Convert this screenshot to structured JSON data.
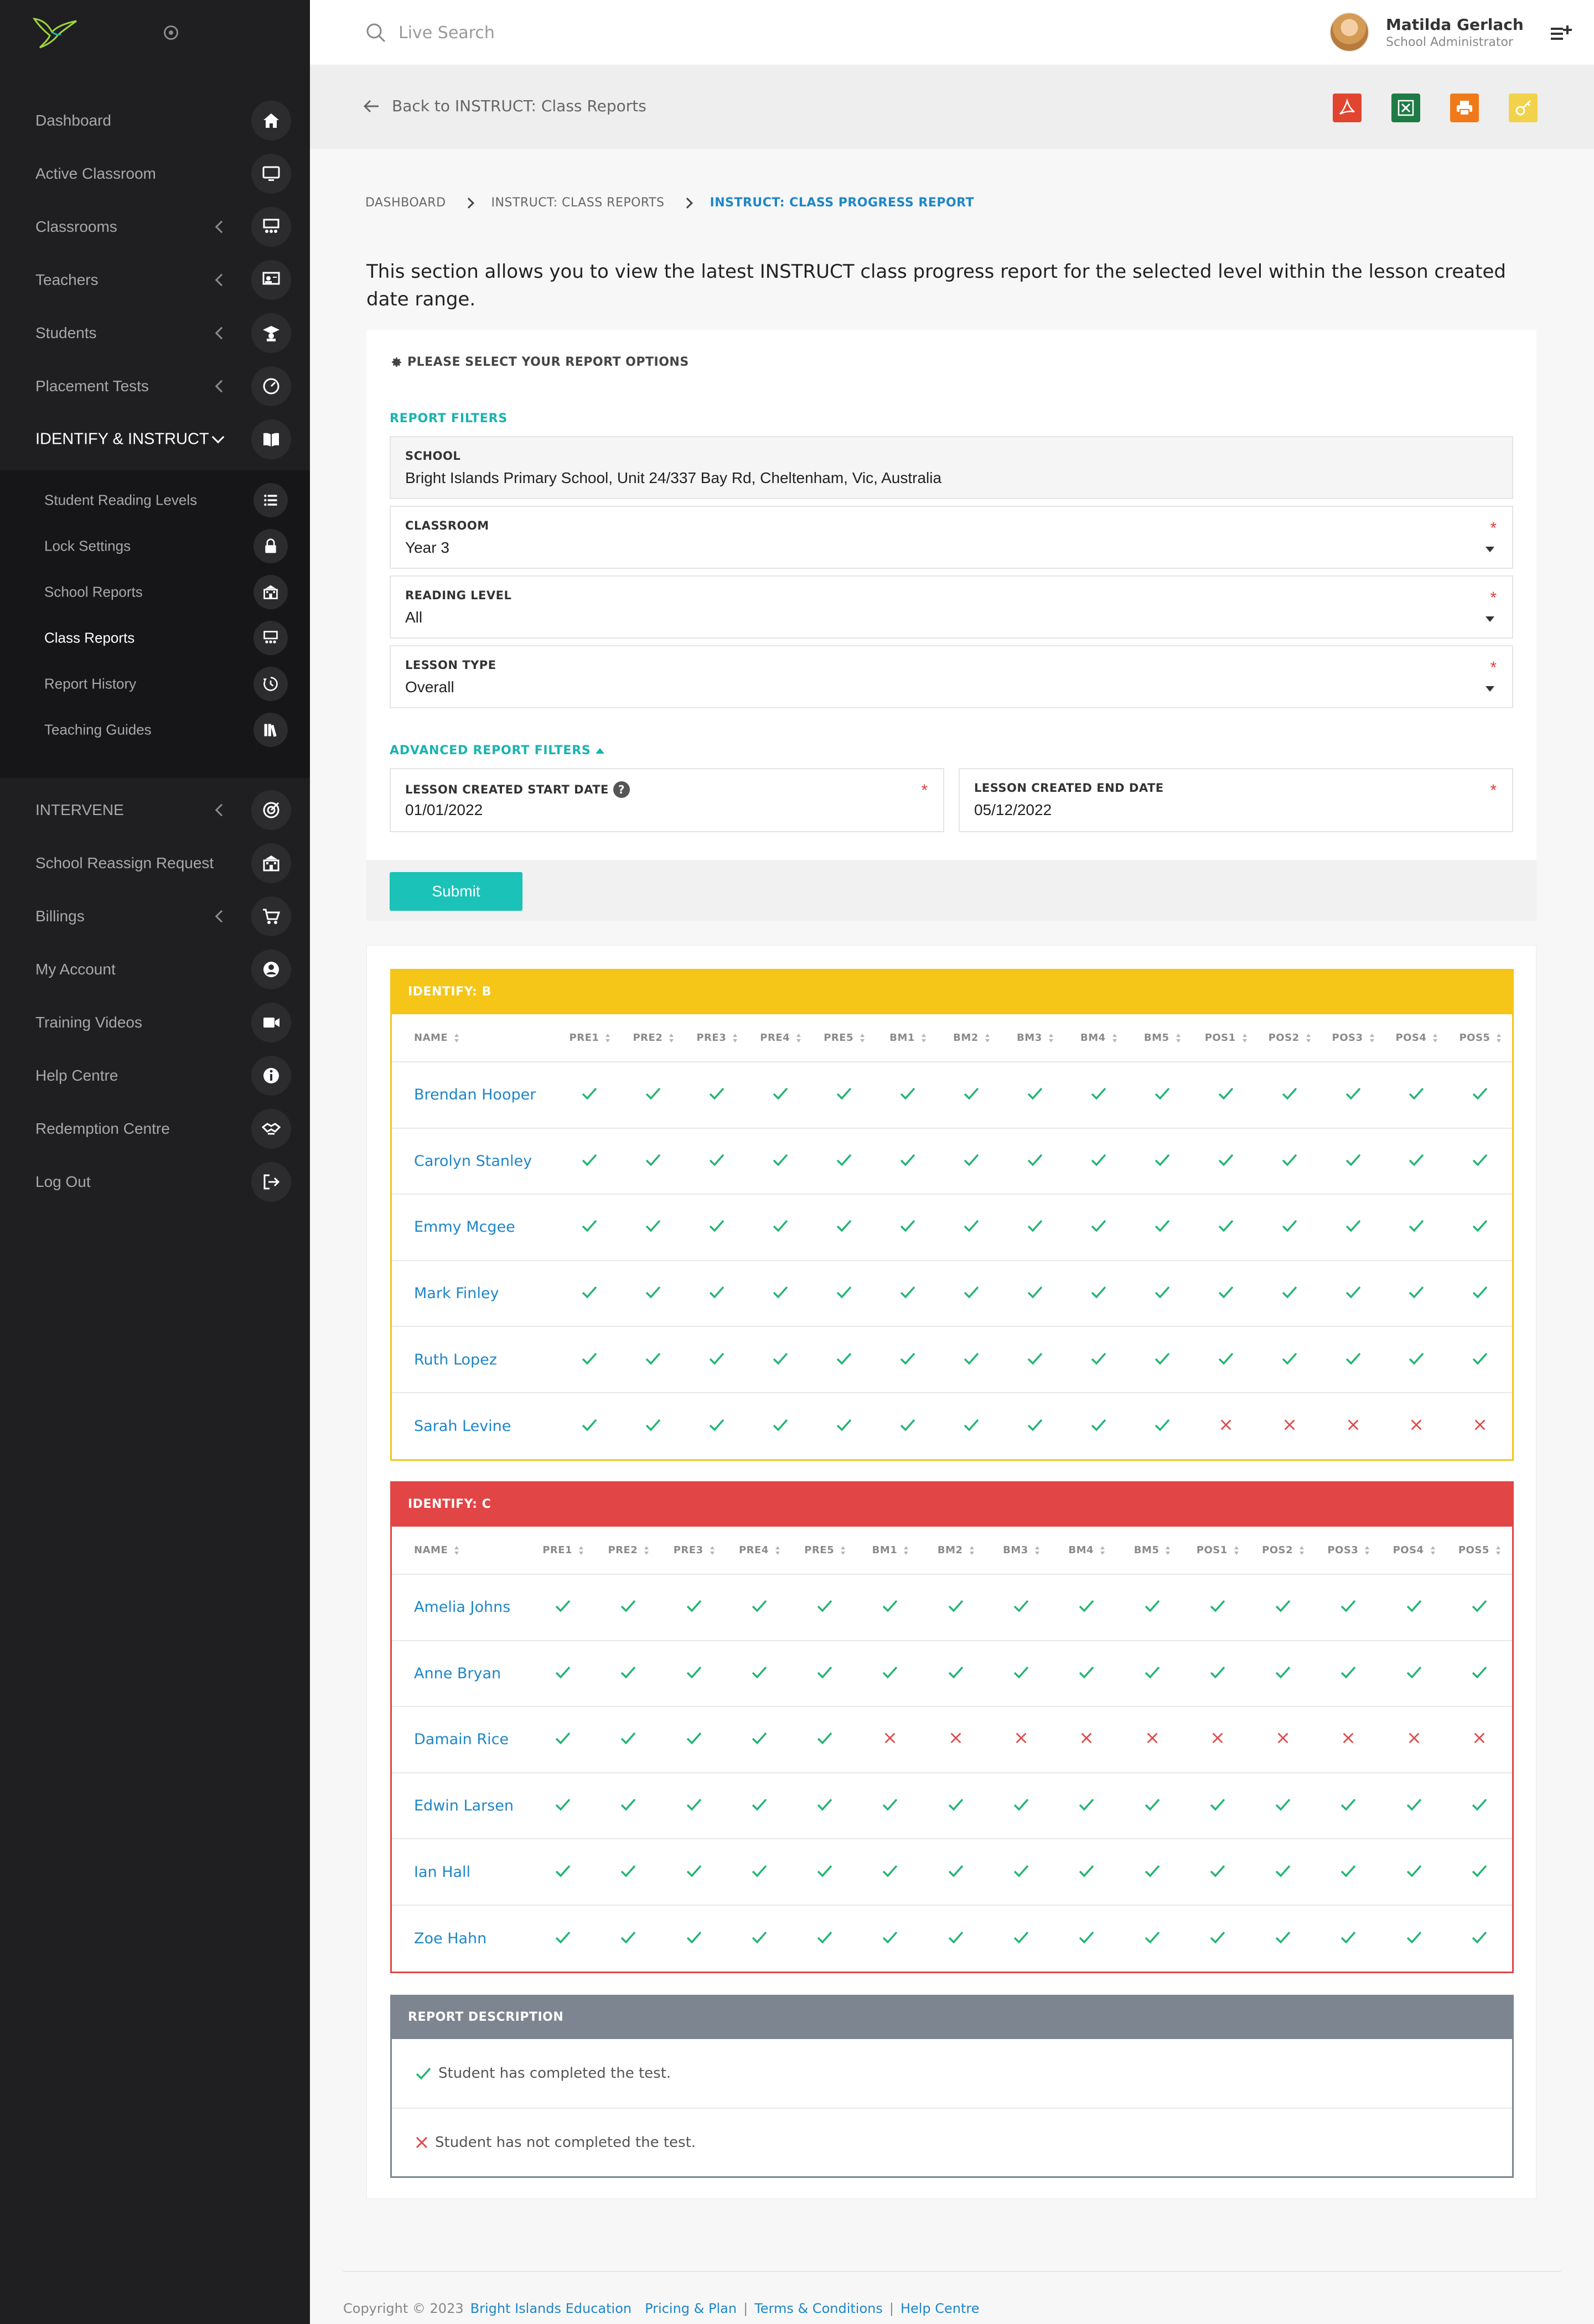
{
  "sidebar": {
    "items": [
      {
        "label": "Dashboard",
        "icon": "home-icon",
        "chevron": false
      },
      {
        "label": "Active Classroom",
        "icon": "monitor-icon",
        "chevron": false
      },
      {
        "label": "Classrooms",
        "icon": "classroom-icon",
        "chevron": true
      },
      {
        "label": "Teachers",
        "icon": "teacher-icon",
        "chevron": true
      },
      {
        "label": "Students",
        "icon": "student-icon",
        "chevron": true
      },
      {
        "label": "Placement Tests",
        "icon": "gauge-icon",
        "chevron": true
      },
      {
        "label": "IDENTIFY & INSTRUCT",
        "icon": "book-icon",
        "chevron": true
      }
    ],
    "subitems": [
      {
        "label": "Student Reading Levels",
        "icon": "list-icon"
      },
      {
        "label": "Lock Settings",
        "icon": "lock-icon"
      },
      {
        "label": "School Reports",
        "icon": "school-icon"
      },
      {
        "label": "Class Reports",
        "icon": "classroom-icon"
      },
      {
        "label": "Report History",
        "icon": "history-icon"
      },
      {
        "label": "Teaching Guides",
        "icon": "books-icon"
      }
    ],
    "items_lower": [
      {
        "label": "INTERVENE",
        "icon": "target-icon",
        "chevron": true
      },
      {
        "label": "School Reassign Request",
        "icon": "school-icon",
        "chevron": false
      },
      {
        "label": "Billings",
        "icon": "cart-icon",
        "chevron": true
      },
      {
        "label": "My Account",
        "icon": "user-circle-icon",
        "chevron": false
      },
      {
        "label": "Training Videos",
        "icon": "video-icon",
        "chevron": false
      },
      {
        "label": "Help Centre",
        "icon": "info-icon",
        "chevron": false
      },
      {
        "label": "Redemption Centre",
        "icon": "handshake-icon",
        "chevron": false
      },
      {
        "label": "Log Out",
        "icon": "logout-icon",
        "chevron": false
      }
    ]
  },
  "topbar": {
    "search_placeholder": "Live Search",
    "user_name": "Matilda Gerlach",
    "user_role": "School Administrator"
  },
  "subheader": {
    "back_label": "Back to INSTRUCT: Class Reports",
    "exports": [
      {
        "name": "pdf-export-icon",
        "color": "#e2452f"
      },
      {
        "name": "excel-export-icon",
        "color": "#1e7b45"
      },
      {
        "name": "print-icon",
        "color": "#f07a1a"
      },
      {
        "name": "key-icon",
        "color": "#f2d24a"
      }
    ]
  },
  "breadcrumb": [
    "DASHBOARD",
    "INSTRUCT: CLASS REPORTS",
    "INSTRUCT: CLASS PROGRESS REPORT"
  ],
  "intro": "This section allows you to view the latest INSTRUCT class progress report for the selected level within the lesson created date range.",
  "filters": {
    "heading": "PLEASE SELECT YOUR REPORT OPTIONS",
    "report_filters_label": "REPORT FILTERS",
    "school": {
      "label": "SCHOOL",
      "value": "Bright Islands Primary School, Unit 24/337 Bay Rd, Cheltenham, Vic, Australia"
    },
    "classroom": {
      "label": "CLASSROOM",
      "value": "Year 3"
    },
    "reading_level": {
      "label": "READING LEVEL",
      "value": "All"
    },
    "lesson_type": {
      "label": "LESSON TYPE",
      "value": "Overall"
    },
    "advanced_label": "ADVANCED REPORT FILTERS",
    "start_date": {
      "label": "LESSON CREATED START DATE",
      "value": "01/01/2022"
    },
    "end_date": {
      "label": "LESSON CREATED END DATE",
      "value": "05/12/2022"
    },
    "required_mark": "*",
    "help_mark": "?",
    "submit_label": "Submit"
  },
  "report": {
    "columns": [
      "NAME",
      "PRE1",
      "PRE2",
      "PRE3",
      "PRE4",
      "PRE5",
      "BM1",
      "BM2",
      "BM3",
      "BM4",
      "BM5",
      "POS1",
      "POS2",
      "POS3",
      "POS4",
      "POS5"
    ],
    "groups": [
      {
        "title": "IDENTIFY: B",
        "color": "#f5c518",
        "students": [
          {
            "name": "Brendan Hooper",
            "done": [
              1,
              1,
              1,
              1,
              1,
              1,
              1,
              1,
              1,
              1,
              1,
              1,
              1,
              1,
              1
            ]
          },
          {
            "name": "Carolyn Stanley",
            "done": [
              1,
              1,
              1,
              1,
              1,
              1,
              1,
              1,
              1,
              1,
              1,
              1,
              1,
              1,
              1
            ]
          },
          {
            "name": "Emmy Mcgee",
            "done": [
              1,
              1,
              1,
              1,
              1,
              1,
              1,
              1,
              1,
              1,
              1,
              1,
              1,
              1,
              1
            ]
          },
          {
            "name": "Mark Finley",
            "done": [
              1,
              1,
              1,
              1,
              1,
              1,
              1,
              1,
              1,
              1,
              1,
              1,
              1,
              1,
              1
            ]
          },
          {
            "name": "Ruth Lopez",
            "done": [
              1,
              1,
              1,
              1,
              1,
              1,
              1,
              1,
              1,
              1,
              1,
              1,
              1,
              1,
              1
            ]
          },
          {
            "name": "Sarah Levine",
            "done": [
              1,
              1,
              1,
              1,
              1,
              1,
              1,
              1,
              1,
              1,
              0,
              0,
              0,
              0,
              0
            ]
          }
        ]
      },
      {
        "title": "IDENTIFY: C",
        "color": "#e24545",
        "students": [
          {
            "name": "Amelia Johns",
            "done": [
              1,
              1,
              1,
              1,
              1,
              1,
              1,
              1,
              1,
              1,
              1,
              1,
              1,
              1,
              1
            ]
          },
          {
            "name": "Anne Bryan",
            "done": [
              1,
              1,
              1,
              1,
              1,
              1,
              1,
              1,
              1,
              1,
              1,
              1,
              1,
              1,
              1
            ]
          },
          {
            "name": "Damain Rice",
            "done": [
              1,
              1,
              1,
              1,
              1,
              0,
              0,
              0,
              0,
              0,
              0,
              0,
              0,
              0,
              0
            ]
          },
          {
            "name": "Edwin Larsen",
            "done": [
              1,
              1,
              1,
              1,
              1,
              1,
              1,
              1,
              1,
              1,
              1,
              1,
              1,
              1,
              1
            ]
          },
          {
            "name": "Ian Hall",
            "done": [
              1,
              1,
              1,
              1,
              1,
              1,
              1,
              1,
              1,
              1,
              1,
              1,
              1,
              1,
              1
            ]
          },
          {
            "name": "Zoe Hahn",
            "done": [
              1,
              1,
              1,
              1,
              1,
              1,
              1,
              1,
              1,
              1,
              1,
              1,
              1,
              1,
              1
            ]
          }
        ]
      }
    ],
    "description": {
      "title": "REPORT DESCRIPTION",
      "completed": "Student has completed the test.",
      "not_completed": "Student has not completed the test."
    }
  },
  "footer": {
    "copyright": "Copyright © 2023",
    "brand": "Bright Islands Education",
    "links": [
      "Pricing & Plan",
      "Terms & Conditions",
      "Help Centre"
    ],
    "separator": "|"
  },
  "colors": {
    "accent": "#1bc2b7",
    "link": "#1e86c8",
    "check": "#22b573",
    "cross": "#e24545"
  }
}
